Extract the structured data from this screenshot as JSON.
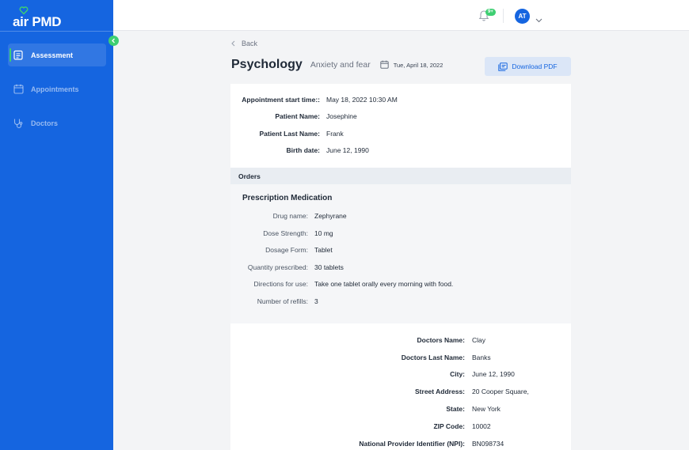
{
  "app": {
    "logo_text": "air PMD"
  },
  "sidebar": {
    "items": [
      {
        "label": "Assessment",
        "icon": "clipboard-icon",
        "active": true
      },
      {
        "label": "Appointments",
        "icon": "calendar-icon",
        "active": false
      },
      {
        "label": "Doctors",
        "icon": "stethoscope-icon",
        "active": false
      }
    ]
  },
  "topbar": {
    "notification_badge": "9+",
    "avatar_initials": "AT"
  },
  "header": {
    "back_label": "Back",
    "title": "Psychology",
    "subtitle": "Anxiety and fear",
    "date": "Tue, April 18, 2022",
    "download_label": "Download PDF"
  },
  "patient": {
    "fields": [
      {
        "label": "Appointment start time::",
        "value": "May 18, 2022 10:30 AM"
      },
      {
        "label": "Patient Name:",
        "value": "Josephine"
      },
      {
        "label": "Patient Last Name:",
        "value": "Frank"
      },
      {
        "label": "Birth date:",
        "value": "June 12, 1990"
      }
    ]
  },
  "orders": {
    "heading": "Orders",
    "prescription_title": "Prescription Medication",
    "fields": [
      {
        "label": "Drug name:",
        "value": "Zephyrane"
      },
      {
        "label": "Dose Strength:",
        "value": "10 mg"
      },
      {
        "label": "Dosage Form:",
        "value": "Tablet"
      },
      {
        "label": "Quantity prescribed:",
        "value": "30 tablets"
      },
      {
        "label": "Directions for use:",
        "value": "Take one tablet orally every morning with food."
      },
      {
        "label": "Number of refills:",
        "value": "3"
      }
    ]
  },
  "doctor": {
    "fields": [
      {
        "label": "Doctors Name:",
        "value": "Clay"
      },
      {
        "label": "Doctors Last Name:",
        "value": "Banks"
      },
      {
        "label": "City:",
        "value": "June 12, 1990"
      },
      {
        "label": "Street Address:",
        "value": "20 Cooper Square,"
      },
      {
        "label": "State:",
        "value": "New York"
      },
      {
        "label": "ZIP Code:",
        "value": "10002"
      },
      {
        "label": "National Provider Identifier (NPI):",
        "value": "BN098734"
      }
    ]
  },
  "colors": {
    "brand": "#1565e0",
    "accent": "#3ecf72"
  }
}
